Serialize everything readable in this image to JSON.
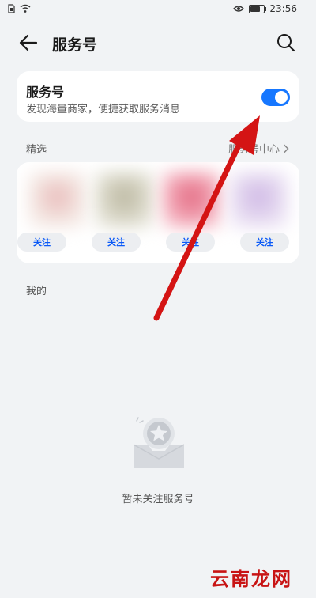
{
  "status_bar": {
    "time": "23:56"
  },
  "header": {
    "title": "服务号"
  },
  "toggle_card": {
    "title": "服务号",
    "description": "发现海量商家，便捷获取服务消息",
    "enabled": true
  },
  "featured": {
    "label": "精选",
    "center_link": "服务号中心",
    "items": [
      {
        "follow_label": "关注"
      },
      {
        "follow_label": "关注"
      },
      {
        "follow_label": "关注"
      },
      {
        "follow_label": "关注"
      }
    ]
  },
  "mine": {
    "label": "我的"
  },
  "empty_state": {
    "text": "暂未关注服务号"
  },
  "watermark": {
    "text": "云南龙网"
  },
  "colors": {
    "accent": "#1677ff",
    "follow_text": "#0a59f7",
    "background": "#f1f3f5",
    "annotation_arrow": "#d41414"
  }
}
